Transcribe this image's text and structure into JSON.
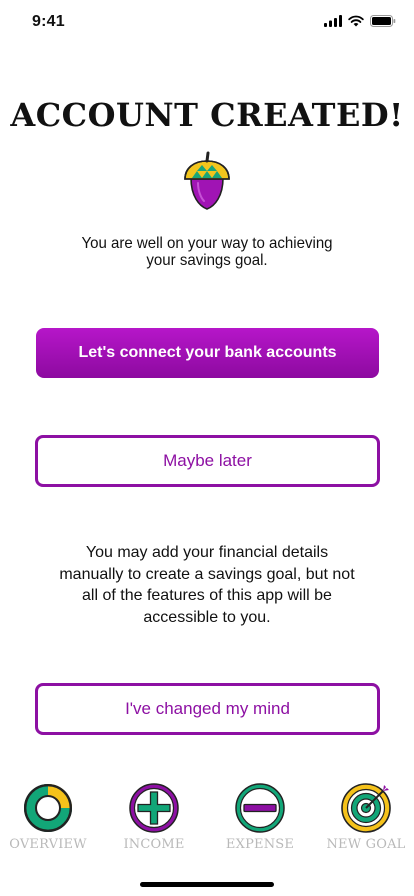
{
  "status_bar": {
    "time": "9:41"
  },
  "title": "ACCOUNT CREATED!",
  "subtitle": "You are well on your way to achieving your savings goal.",
  "connect_button": "Let's connect your bank accounts",
  "later_button": "Maybe later",
  "note": "You may add your financial details manually to create a savings goal, but not all of the features of this app will be accessible to you.",
  "changed_button": "I've changed my mind",
  "tabs": [
    {
      "label": "OVERVIEW",
      "icon": "donut-chart-icon"
    },
    {
      "label": "INCOME",
      "icon": "plus-circle-icon"
    },
    {
      "label": "EXPENSE",
      "icon": "minus-circle-icon"
    },
    {
      "label": "NEW GOAL",
      "icon": "target-icon"
    }
  ],
  "colors": {
    "primary": "#A812BB",
    "outline": "#8D10A3",
    "green": "#12A678",
    "yellow": "#F5C21B",
    "tab_label": "#B9B9B9"
  }
}
